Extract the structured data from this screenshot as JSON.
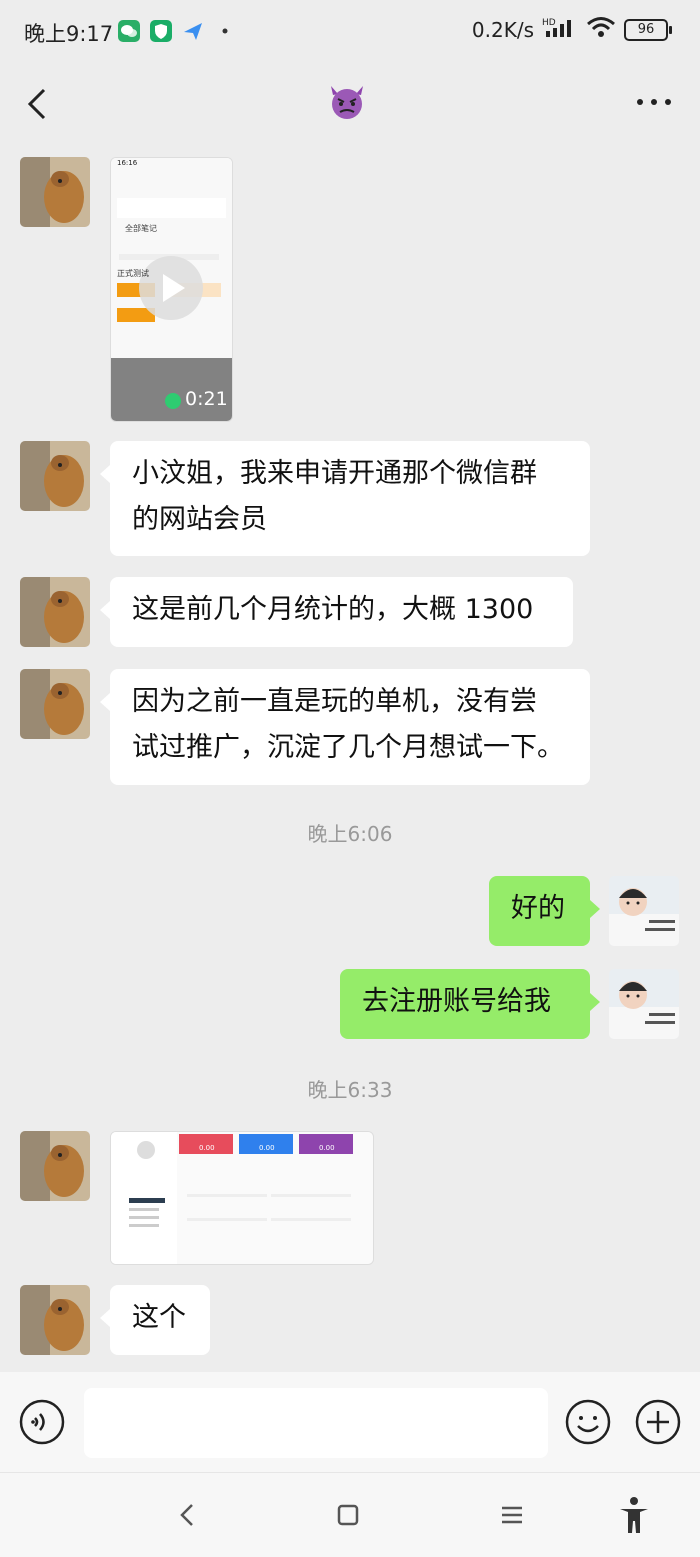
{
  "status_bar": {
    "time": "晚上9:17",
    "network_speed": "0.2K/s",
    "battery": "96",
    "icons": [
      "wechat-icon",
      "shield-icon",
      "send-app-icon",
      "dot-icon",
      "signal-icon",
      "wifi-icon",
      "battery-icon"
    ]
  },
  "header": {
    "title_emoji": "angry-devil-emoji",
    "back_icon": "back-arrow-icon",
    "more_icon": "more-dots-icon"
  },
  "messages": [
    {
      "side": "left",
      "type": "video",
      "duration": "0:21",
      "thumb_text": {
        "time": "16:16",
        "tab": "全部笔记",
        "heading": "正式测试"
      }
    },
    {
      "side": "left",
      "type": "text",
      "line1": "小汶姐，我来申请开通那个微信群",
      "line2": "的网站会员"
    },
    {
      "side": "left",
      "type": "text",
      "line1": "这是前几个月统计的，大概 1300"
    },
    {
      "side": "left",
      "type": "text",
      "line1": "因为之前一直是玩的单机，没有尝",
      "line2": "试过推广，沉淀了几个月想试一下。"
    },
    {
      "type": "timestamp",
      "text": "晚上6:06"
    },
    {
      "side": "right",
      "type": "text",
      "line1": "好的"
    },
    {
      "side": "right",
      "type": "text",
      "line1": "去注册账号给我"
    },
    {
      "type": "timestamp",
      "text": "晚上6:33"
    },
    {
      "side": "left",
      "type": "image",
      "values": [
        "0.00",
        "0.00",
        "0.00"
      ]
    },
    {
      "side": "left",
      "type": "text",
      "line1": "这个"
    }
  ],
  "input_bar": {
    "placeholder": "",
    "voice_icon": "voice-icon",
    "emoji_icon": "emoji-icon",
    "plus_icon": "plus-icon"
  },
  "nav_bar": {
    "icons": [
      "nav-back-icon",
      "nav-home-icon",
      "nav-menu-icon",
      "accessibility-icon"
    ]
  },
  "colors": {
    "background": "#ededed",
    "bubble_left": "#ffffff",
    "bubble_right": "#95ec69",
    "timestamp": "#999999"
  }
}
